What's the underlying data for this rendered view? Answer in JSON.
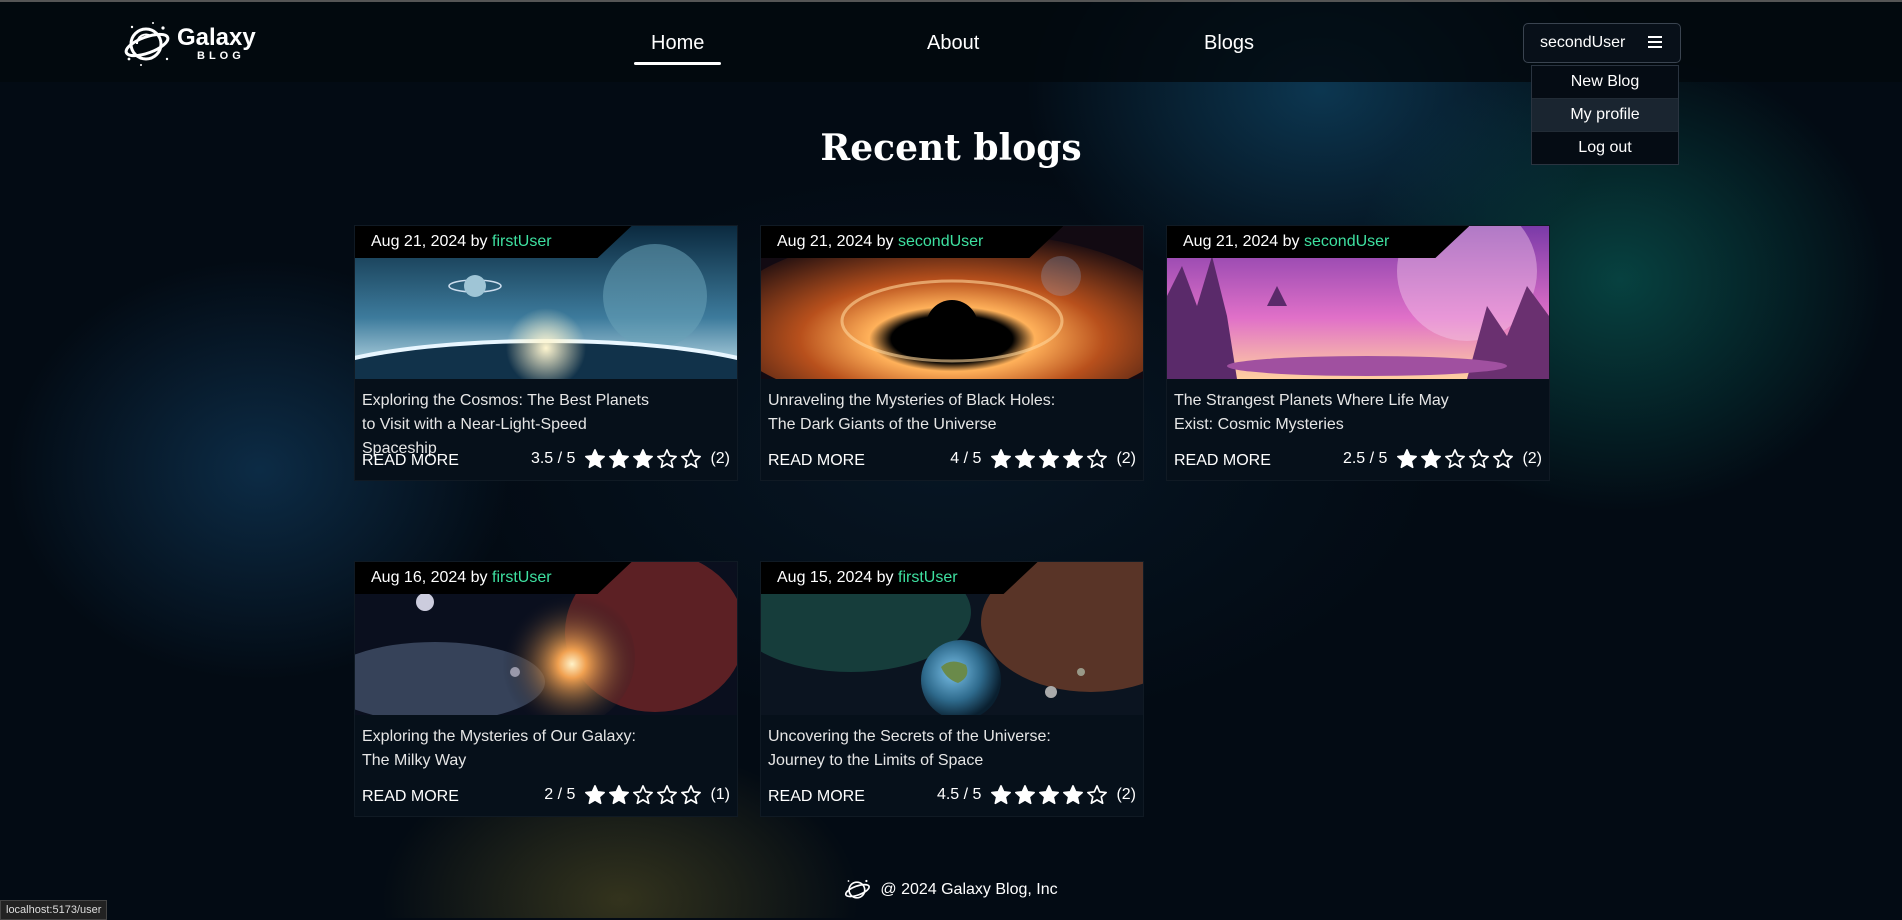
{
  "brand": {
    "name": "Galaxy",
    "sub": "BLOG"
  },
  "nav": {
    "home": "Home",
    "about": "About",
    "blogs": "Blogs"
  },
  "user": {
    "name": "secondUser",
    "menu": {
      "new_blog": "New Blog",
      "my_profile": "My profile",
      "log_out": "Log out"
    }
  },
  "heading": "Recent blogs",
  "common": {
    "by": "by",
    "read_more": "READ MORE"
  },
  "posts": [
    {
      "date": "Aug 21, 2024",
      "author": "firstUser",
      "title": "Exploring the Cosmos: The Best Planets to Visit with a Near-Light-Speed Spaceship",
      "score": "3.5 / 5",
      "rating": 3.5,
      "count": "(2)",
      "image": "cosmos-planets"
    },
    {
      "date": "Aug 21, 2024",
      "author": "secondUser",
      "title": "Unraveling the Mysteries of Black Holes: The Dark Giants of the Universe",
      "score": "4 / 5",
      "rating": 4,
      "count": "(2)",
      "image": "black-hole"
    },
    {
      "date": "Aug 21, 2024",
      "author": "secondUser",
      "title": "The Strangest Planets Where Life May Exist: Cosmic Mysteries",
      "score": "2.5 / 5",
      "rating": 2.5,
      "count": "(2)",
      "image": "alien-planet"
    },
    {
      "date": "Aug 16, 2024",
      "author": "firstUser",
      "title": "Exploring the Mysteries of Our Galaxy: The Milky Way",
      "score": "2 / 5",
      "rating": 2,
      "count": "(1)",
      "image": "milky-way"
    },
    {
      "date": "Aug 15, 2024",
      "author": "firstUser",
      "title": "Uncovering the Secrets of the Universe: Journey to the Limits of Space",
      "score": "4.5 / 5",
      "rating": 4.5,
      "count": "(2)",
      "image": "earth-universe"
    }
  ],
  "footer": {
    "text": "@ 2024 Galaxy Blog, Inc"
  },
  "status_url": "localhost:5173/user",
  "colors": {
    "author": "#3ee0a0",
    "background": "#030b14"
  }
}
